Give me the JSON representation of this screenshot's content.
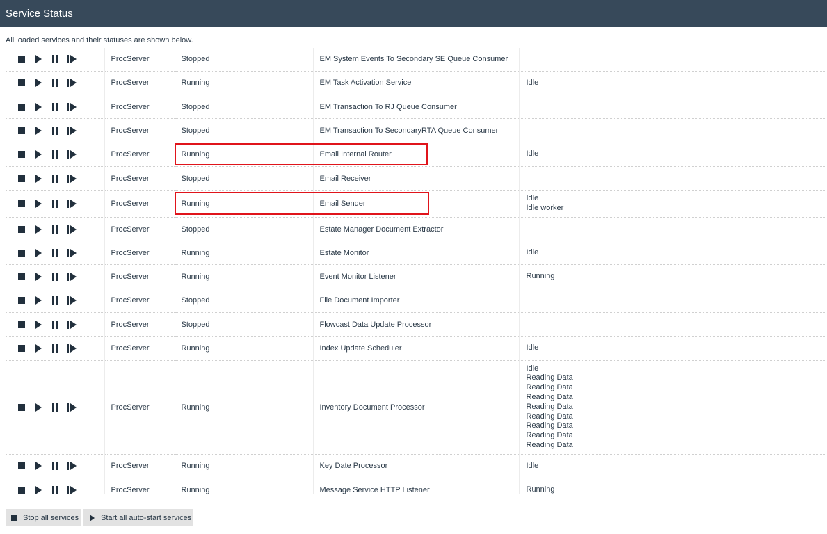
{
  "header": {
    "title": "Service Status"
  },
  "subtitle": "All loaded services and their statuses are shown below.",
  "row_icons": [
    "stop-icon",
    "play-icon",
    "pause-icon",
    "resume-icon"
  ],
  "services": [
    {
      "server": "ProcServer",
      "state": "Stopped",
      "name": "EM System Events To Secondary SE Queue Consumer",
      "details": []
    },
    {
      "server": "ProcServer",
      "state": "Running",
      "name": "EM Task Activation Service",
      "details": [
        "Idle"
      ]
    },
    {
      "server": "ProcServer",
      "state": "Stopped",
      "name": "EM Transaction To RJ Queue Consumer",
      "details": []
    },
    {
      "server": "ProcServer",
      "state": "Stopped",
      "name": "EM Transaction To SecondaryRTA Queue Consumer",
      "details": []
    },
    {
      "server": "ProcServer",
      "state": "Running",
      "name": "Email Internal Router",
      "details": [
        "Idle"
      ],
      "highlighted": true
    },
    {
      "server": "ProcServer",
      "state": "Stopped",
      "name": "Email Receiver",
      "details": []
    },
    {
      "server": "ProcServer",
      "state": "Running",
      "name": "Email Sender",
      "details": [
        "Idle",
        "Idle worker"
      ],
      "highlighted": true
    },
    {
      "server": "ProcServer",
      "state": "Stopped",
      "name": "Estate Manager Document Extractor",
      "details": []
    },
    {
      "server": "ProcServer",
      "state": "Running",
      "name": "Estate Monitor",
      "details": [
        "Idle"
      ]
    },
    {
      "server": "ProcServer",
      "state": "Running",
      "name": "Event Monitor Listener",
      "details": [
        "Running"
      ]
    },
    {
      "server": "ProcServer",
      "state": "Stopped",
      "name": "File Document Importer",
      "details": []
    },
    {
      "server": "ProcServer",
      "state": "Stopped",
      "name": "Flowcast Data Update Processor",
      "details": []
    },
    {
      "server": "ProcServer",
      "state": "Running",
      "name": "Index Update Scheduler",
      "details": [
        "Idle"
      ]
    },
    {
      "server": "ProcServer",
      "state": "Running",
      "name": "Inventory Document Processor",
      "details": [
        "Idle",
        "Reading Data",
        "Reading Data",
        "Reading Data",
        "Reading Data",
        "Reading Data",
        "Reading Data",
        "Reading Data",
        "Reading Data"
      ]
    },
    {
      "server": "ProcServer",
      "state": "Running",
      "name": "Key Date Processor",
      "details": [
        "Idle"
      ]
    },
    {
      "server": "ProcServer",
      "state": "Running",
      "name": "Message Service HTTP Listener",
      "details": [
        "Running"
      ]
    }
  ],
  "footer": {
    "stop_all_label": "Stop all services",
    "start_all_label": "Start all auto-start services"
  },
  "colors": {
    "header_bg": "#37495a",
    "highlight_border": "#e0141b",
    "button_bg": "#e2e2e2"
  }
}
